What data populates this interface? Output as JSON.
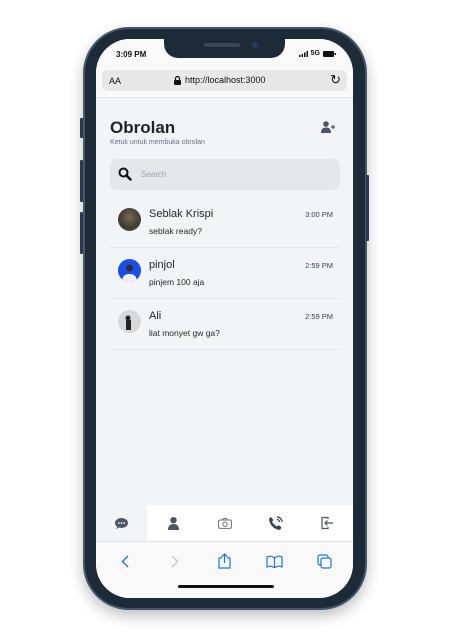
{
  "status": {
    "time": "3:09 PM",
    "network": "5G"
  },
  "browser": {
    "text_size": "AA",
    "url": "http://localhost:3000"
  },
  "header": {
    "title": "Obrolan",
    "subtitle": "Ketuk untuk membuka obrolan"
  },
  "search": {
    "placeholder": "Search"
  },
  "chats": [
    {
      "name": "Seblak Krispi",
      "message": "seblak ready?",
      "time": "3:00 PM"
    },
    {
      "name": "pinjol",
      "message": "pinjem 100 aja",
      "time": "2:59 PM"
    },
    {
      "name": "Ali",
      "message": "liat monyet gw ga?",
      "time": "2:59 PM"
    }
  ],
  "nav": [
    {
      "icon": "chat-icon"
    },
    {
      "icon": "user-icon"
    },
    {
      "icon": "camera-icon"
    },
    {
      "icon": "phone-icon"
    },
    {
      "icon": "logout-icon"
    }
  ],
  "colors": {
    "accent": "#1a73e8",
    "background": "#f3f4f6"
  }
}
